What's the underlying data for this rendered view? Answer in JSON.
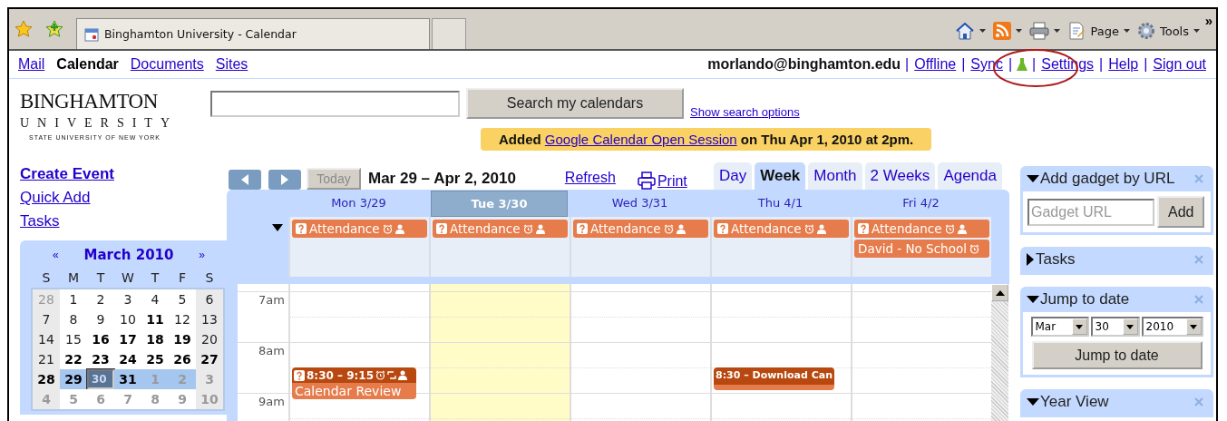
{
  "browser": {
    "tab": {
      "title": "Binghamton University - Calendar"
    },
    "commands": [
      {
        "kind": "home"
      },
      {
        "kind": "feeds"
      },
      {
        "kind": "print"
      },
      {
        "kind": "page",
        "label": "Page"
      },
      {
        "kind": "tools",
        "label": "Tools"
      }
    ],
    "overflow": "»"
  },
  "apps_nav": [
    {
      "label": "Mail",
      "selected": false
    },
    {
      "label": "Calendar",
      "selected": true
    },
    {
      "label": "Documents",
      "selected": false
    },
    {
      "label": "Sites",
      "selected": false
    }
  ],
  "account": {
    "email": "morlando@binghamton.edu",
    "separator": "|",
    "links": [
      {
        "kind": "link",
        "label": "Offline"
      },
      {
        "kind": "link",
        "label": "Sync"
      },
      {
        "kind": "labs"
      },
      {
        "kind": "link",
        "label": "Settings"
      },
      {
        "kind": "link",
        "label": "Help"
      },
      {
        "kind": "link",
        "label": "Sign out"
      }
    ]
  },
  "logo": {
    "name": "BINGHAMTON",
    "line2": "UNIVERSITY",
    "line3": "STATE UNIVERSITY OF NEW YORK"
  },
  "search": {
    "button": "Search my calendars",
    "options_link": "Show search options"
  },
  "notice": {
    "prefix": "Added",
    "link": "Google Calendar Open Session",
    "suffix": "on Thu Apr 1, 2010 at 2pm."
  },
  "actions": [
    {
      "label": "Create Event",
      "kind": "primary"
    },
    {
      "label": "Quick Add",
      "kind": "link"
    },
    {
      "label": "Tasks",
      "kind": "link"
    }
  ],
  "mini_cal": {
    "prev": "«",
    "title": "March 2010",
    "next": "»",
    "weekdays": [
      "S",
      "M",
      "T",
      "W",
      "T",
      "F",
      "S"
    ],
    "weeks": [
      [
        {
          "d": "28",
          "other_month": true,
          "bold": false,
          "in_week": false,
          "selected": false
        },
        {
          "d": "1",
          "other_month": false,
          "bold": false,
          "in_week": false,
          "selected": false
        },
        {
          "d": "2",
          "other_month": false,
          "bold": false,
          "in_week": false,
          "selected": false
        },
        {
          "d": "3",
          "other_month": false,
          "bold": false,
          "in_week": false,
          "selected": false
        },
        {
          "d": "4",
          "other_month": false,
          "bold": false,
          "in_week": false,
          "selected": false
        },
        {
          "d": "5",
          "other_month": false,
          "bold": false,
          "in_week": false,
          "selected": false
        },
        {
          "d": "6",
          "other_month": false,
          "bold": false,
          "in_week": false,
          "selected": false
        }
      ],
      [
        {
          "d": "7",
          "other_month": false,
          "bold": false,
          "in_week": false,
          "selected": false
        },
        {
          "d": "8",
          "other_month": false,
          "bold": false,
          "in_week": false,
          "selected": false
        },
        {
          "d": "9",
          "other_month": false,
          "bold": false,
          "in_week": false,
          "selected": false
        },
        {
          "d": "10",
          "other_month": false,
          "bold": false,
          "in_week": false,
          "selected": false
        },
        {
          "d": "11",
          "other_month": false,
          "bold": true,
          "in_week": false,
          "selected": false
        },
        {
          "d": "12",
          "other_month": false,
          "bold": false,
          "in_week": false,
          "selected": false
        },
        {
          "d": "13",
          "other_month": false,
          "bold": false,
          "in_week": false,
          "selected": false
        }
      ],
      [
        {
          "d": "14",
          "other_month": false,
          "bold": false,
          "in_week": false,
          "selected": false
        },
        {
          "d": "15",
          "other_month": false,
          "bold": false,
          "in_week": false,
          "selected": false
        },
        {
          "d": "16",
          "other_month": false,
          "bold": true,
          "in_week": false,
          "selected": false
        },
        {
          "d": "17",
          "other_month": false,
          "bold": true,
          "in_week": false,
          "selected": false
        },
        {
          "d": "18",
          "other_month": false,
          "bold": true,
          "in_week": false,
          "selected": false
        },
        {
          "d": "19",
          "other_month": false,
          "bold": true,
          "in_week": false,
          "selected": false
        },
        {
          "d": "20",
          "other_month": false,
          "bold": false,
          "in_week": false,
          "selected": false
        }
      ],
      [
        {
          "d": "21",
          "other_month": false,
          "bold": false,
          "in_week": false,
          "selected": false
        },
        {
          "d": "22",
          "other_month": false,
          "bold": true,
          "in_week": false,
          "selected": false
        },
        {
          "d": "23",
          "other_month": false,
          "bold": true,
          "in_week": false,
          "selected": false
        },
        {
          "d": "24",
          "other_month": false,
          "bold": true,
          "in_week": false,
          "selected": false
        },
        {
          "d": "25",
          "other_month": false,
          "bold": true,
          "in_week": false,
          "selected": false
        },
        {
          "d": "26",
          "other_month": false,
          "bold": true,
          "in_week": false,
          "selected": false
        },
        {
          "d": "27",
          "other_month": false,
          "bold": true,
          "in_week": false,
          "selected": false
        }
      ],
      [
        {
          "d": "28",
          "other_month": false,
          "bold": true,
          "in_week": false,
          "selected": false
        },
        {
          "d": "29",
          "other_month": false,
          "bold": true,
          "in_week": true,
          "selected": false
        },
        {
          "d": "30",
          "other_month": false,
          "bold": true,
          "in_week": true,
          "selected": true
        },
        {
          "d": "31",
          "other_month": false,
          "bold": true,
          "in_week": true,
          "selected": false
        },
        {
          "d": "1",
          "other_month": true,
          "bold": true,
          "in_week": true,
          "selected": false
        },
        {
          "d": "2",
          "other_month": true,
          "bold": true,
          "in_week": true,
          "selected": false
        },
        {
          "d": "3",
          "other_month": true,
          "bold": true,
          "in_week": false,
          "selected": false
        }
      ],
      [
        {
          "d": "4",
          "other_month": true,
          "bold": true,
          "in_week": false,
          "selected": false
        },
        {
          "d": "5",
          "other_month": true,
          "bold": true,
          "in_week": false,
          "selected": false
        },
        {
          "d": "6",
          "other_month": true,
          "bold": true,
          "in_week": false,
          "selected": false
        },
        {
          "d": "7",
          "other_month": true,
          "bold": true,
          "in_week": false,
          "selected": false
        },
        {
          "d": "8",
          "other_month": true,
          "bold": true,
          "in_week": false,
          "selected": false
        },
        {
          "d": "9",
          "other_month": true,
          "bold": true,
          "in_week": false,
          "selected": false
        },
        {
          "d": "10",
          "other_month": true,
          "bold": true,
          "in_week": false,
          "selected": false
        }
      ]
    ]
  },
  "toolbar": {
    "today": "Today",
    "today_disabled": true,
    "range": "Mar 29 – Apr 2, 2010",
    "refresh": "Refresh",
    "print": "Print"
  },
  "views": [
    {
      "label": "Day",
      "selected": false
    },
    {
      "label": "Week",
      "selected": true
    },
    {
      "label": "Month",
      "selected": false
    },
    {
      "label": "2 Weeks",
      "selected": false
    },
    {
      "label": "Agenda",
      "selected": false
    }
  ],
  "hours": [
    "7am",
    "8am",
    "9am"
  ],
  "days": [
    {
      "header": "Mon 3/29",
      "selected": false,
      "all_day": [
        {
          "title": "Attendance",
          "kind": "invite"
        }
      ],
      "events": [
        {
          "kind": "invite",
          "time": "8:30 – 9:15",
          "title": "Calendar Review"
        }
      ]
    },
    {
      "header": "Tue 3/30",
      "selected": true,
      "all_day": [
        {
          "title": "Attendance",
          "kind": "invite"
        }
      ]
    },
    {
      "header": "Wed 3/31",
      "selected": false,
      "all_day": [
        {
          "title": "Attendance",
          "kind": "invite"
        }
      ]
    },
    {
      "header": "Thu 4/1",
      "selected": false,
      "all_day": [
        {
          "title": "Attendance",
          "kind": "invite"
        }
      ],
      "events": [
        {
          "kind": "compact",
          "time": "8:30 – Download Can"
        }
      ]
    },
    {
      "header": "Fri 4/2",
      "selected": false,
      "all_day": [
        {
          "title": "Attendance",
          "kind": "invite"
        },
        {
          "title": "David - No School",
          "kind": "plain"
        }
      ]
    }
  ],
  "gadgets": [
    {
      "kind": "add_url",
      "title": "Add gadget by URL",
      "expanded": true,
      "placeholder": "Gadget URL",
      "button": "Add"
    },
    {
      "title": "Tasks",
      "expanded": false
    },
    {
      "kind": "jump",
      "title": "Jump to date",
      "expanded": true,
      "month": "Mar",
      "day": "30",
      "year": "2010",
      "button": "Jump to date"
    },
    {
      "title": "Year View",
      "expanded": true
    }
  ]
}
